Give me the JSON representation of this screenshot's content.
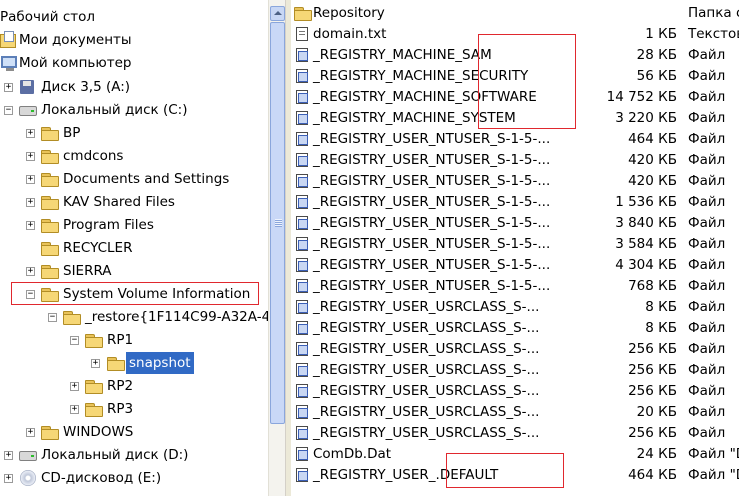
{
  "tree": {
    "items": [
      {
        "label": "Рабочий стол"
      },
      {
        "label": "Мои документы"
      },
      {
        "label": "Мой компьютер"
      },
      {
        "label": "Диск 3,5 (A:)"
      },
      {
        "label": "Локальный диск (C:)"
      },
      {
        "label": "BP"
      },
      {
        "label": "cmdcons"
      },
      {
        "label": "Documents and Settings"
      },
      {
        "label": "KAV Shared Files"
      },
      {
        "label": "Program Files"
      },
      {
        "label": "RECYCLER"
      },
      {
        "label": "SIERRA"
      },
      {
        "label": "System Volume Information"
      },
      {
        "label": "_restore{1F114C99-A32A-4"
      },
      {
        "label": "RP1"
      },
      {
        "label": "snapshot"
      },
      {
        "label": "RP2"
      },
      {
        "label": "RP3"
      },
      {
        "label": "WINDOWS"
      },
      {
        "label": "Локальный диск (D:)"
      },
      {
        "label": "CD-дисковод (E:)"
      }
    ],
    "expanders": {
      "plus": "+",
      "minus": "−"
    }
  },
  "files": [
    {
      "name": "Repository",
      "size": "",
      "type": "Папка с"
    },
    {
      "name": "domain.txt",
      "size": "1 КБ",
      "type": "Текстов"
    },
    {
      "name": "_REGISTRY_MACHINE_SAM",
      "size": "28 КБ",
      "type": "Файл"
    },
    {
      "name": "_REGISTRY_MACHINE_SECURITY",
      "size": "56 КБ",
      "type": "Файл"
    },
    {
      "name": "_REGISTRY_MACHINE_SOFTWARE",
      "size": "14 752 КБ",
      "type": "Файл"
    },
    {
      "name": "_REGISTRY_MACHINE_SYSTEM",
      "size": "3 220 КБ",
      "type": "Файл"
    },
    {
      "name": "_REGISTRY_USER_NTUSER_S-1-5-...",
      "size": "464 КБ",
      "type": "Файл"
    },
    {
      "name": "_REGISTRY_USER_NTUSER_S-1-5-...",
      "size": "420 КБ",
      "type": "Файл"
    },
    {
      "name": "_REGISTRY_USER_NTUSER_S-1-5-...",
      "size": "420 КБ",
      "type": "Файл"
    },
    {
      "name": "_REGISTRY_USER_NTUSER_S-1-5-...",
      "size": "1 536 КБ",
      "type": "Файл"
    },
    {
      "name": "_REGISTRY_USER_NTUSER_S-1-5-...",
      "size": "3 840 КБ",
      "type": "Файл"
    },
    {
      "name": "_REGISTRY_USER_NTUSER_S-1-5-...",
      "size": "3 584 КБ",
      "type": "Файл"
    },
    {
      "name": "_REGISTRY_USER_NTUSER_S-1-5-...",
      "size": "4 304 КБ",
      "type": "Файл"
    },
    {
      "name": "_REGISTRY_USER_NTUSER_S-1-5-...",
      "size": "768 КБ",
      "type": "Файл"
    },
    {
      "name": "_REGISTRY_USER_USRCLASS_S-...",
      "size": "8 КБ",
      "type": "Файл"
    },
    {
      "name": "_REGISTRY_USER_USRCLASS_S-...",
      "size": "8 КБ",
      "type": "Файл"
    },
    {
      "name": "_REGISTRY_USER_USRCLASS_S-...",
      "size": "256 КБ",
      "type": "Файл"
    },
    {
      "name": "_REGISTRY_USER_USRCLASS_S-...",
      "size": "256 КБ",
      "type": "Файл"
    },
    {
      "name": "_REGISTRY_USER_USRCLASS_S-...",
      "size": "256 КБ",
      "type": "Файл"
    },
    {
      "name": "_REGISTRY_USER_USRCLASS_S-...",
      "size": "20 КБ",
      "type": "Файл"
    },
    {
      "name": "_REGISTRY_USER_USRCLASS_S-...",
      "size": "256 КБ",
      "type": "Файл"
    },
    {
      "name": "ComDb.Dat",
      "size": "24 КБ",
      "type": "Файл \"D"
    },
    {
      "name": "_REGISTRY_USER_.DEFAULT",
      "size": "464 КБ",
      "type": "Файл \"D"
    }
  ],
  "colors": {
    "selection": "#316ac5",
    "annotation": "#e0282e",
    "tree_lines": "#9a9a9a"
  }
}
